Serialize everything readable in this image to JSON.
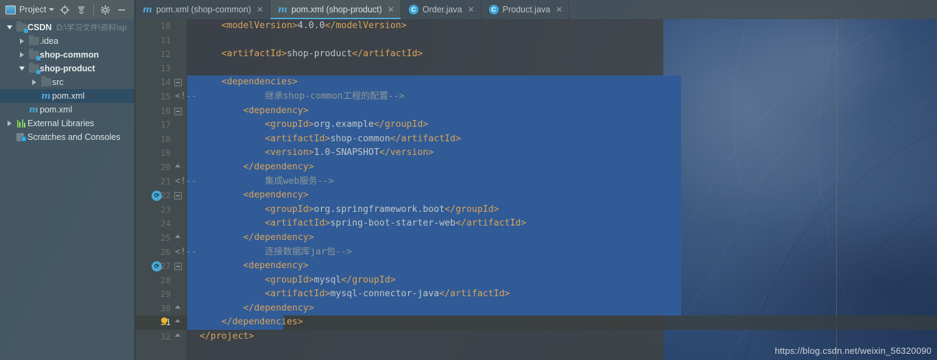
{
  "sidebar": {
    "toolbar": {
      "title": "Project",
      "title_icon": "project-panel-icon",
      "caret_icon": "chevron-down-icon",
      "locate_icon": "locate-target-icon",
      "collapse_icon": "collapse-all-icon",
      "settings_icon": "gear-icon",
      "hide_icon": "minimize-icon"
    },
    "tree": [
      {
        "label": "CSDN",
        "path": "D:\\学习文件\\资料\\sp",
        "icon": "folder-module-icon",
        "twist": "open",
        "depth": 0,
        "bold": true,
        "selected": false
      },
      {
        "label": ".idea",
        "path": "",
        "icon": "folder-icon",
        "twist": "closed",
        "depth": 1,
        "bold": false,
        "selected": false
      },
      {
        "label": "shop-common",
        "path": "",
        "icon": "folder-module-icon",
        "twist": "closed",
        "depth": 1,
        "bold": true,
        "selected": false
      },
      {
        "label": "shop-product",
        "path": "",
        "icon": "folder-module-icon",
        "twist": "open",
        "depth": 1,
        "bold": true,
        "selected": false
      },
      {
        "label": "src",
        "path": "",
        "icon": "folder-icon",
        "twist": "closed",
        "depth": 2,
        "bold": false,
        "selected": false
      },
      {
        "label": "pom.xml",
        "path": "",
        "icon": "maven-file-icon",
        "twist": "none",
        "depth": 2,
        "bold": false,
        "selected": true
      },
      {
        "label": "pom.xml",
        "path": "",
        "icon": "maven-file-icon",
        "twist": "none",
        "depth": 1,
        "bold": false,
        "selected": false
      },
      {
        "label": "External Libraries",
        "path": "",
        "icon": "external-libraries-icon",
        "twist": "closed",
        "depth": 0,
        "bold": false,
        "selected": false
      },
      {
        "label": "Scratches and Consoles",
        "path": "",
        "icon": "scratches-icon",
        "twist": "none",
        "depth": 0,
        "bold": false,
        "selected": false
      }
    ]
  },
  "tabs": [
    {
      "label": "pom.xml (shop-common)",
      "icon": "maven-file-icon",
      "icon_letter": "m",
      "active": false,
      "close_icon": "close-icon"
    },
    {
      "label": "pom.xml (shop-product)",
      "icon": "maven-file-icon",
      "icon_letter": "m",
      "active": true,
      "close_icon": "close-icon"
    },
    {
      "label": "Order.java",
      "icon": "java-class-icon",
      "icon_letter": "C",
      "active": false,
      "close_icon": "close-icon"
    },
    {
      "label": "Product.java",
      "icon": "java-class-icon",
      "icon_letter": "C",
      "active": false,
      "close_icon": "close-icon"
    }
  ],
  "editor": {
    "first_line_number": 10,
    "current_line_number": 31,
    "lines": [
      {
        "num": 10,
        "indent": 4,
        "selected": false,
        "spans": [
          {
            "t": "<modelVersion>",
            "c": "tg"
          },
          {
            "t": "4.0.0",
            "c": "val"
          },
          {
            "t": "</modelVersion>",
            "c": "tg"
          }
        ]
      },
      {
        "num": 11,
        "indent": 0,
        "selected": false,
        "spans": []
      },
      {
        "num": 12,
        "indent": 4,
        "selected": false,
        "spans": [
          {
            "t": "<artifactId>",
            "c": "tg"
          },
          {
            "t": "shop-product",
            "c": "val"
          },
          {
            "t": "</artifactId>",
            "c": "tg"
          }
        ]
      },
      {
        "num": 13,
        "indent": 0,
        "selected": false,
        "spans": []
      },
      {
        "num": 14,
        "indent": 4,
        "selected": true,
        "fold": "minus",
        "sel_start": 0,
        "sel_width": 720,
        "spans": [
          {
            "t": "<dependencies>",
            "c": "tg"
          }
        ]
      },
      {
        "num": 15,
        "indent": 12,
        "selected": true,
        "comment_marker": "<!--",
        "sel_start": 0,
        "sel_width": 720,
        "spans": [
          {
            "t": "继承shop-common工程的配置-->",
            "c": "cm"
          }
        ]
      },
      {
        "num": 16,
        "indent": 8,
        "selected": true,
        "fold": "minus",
        "sel_start": 0,
        "sel_width": 720,
        "spans": [
          {
            "t": "<dependency>",
            "c": "tg"
          }
        ]
      },
      {
        "num": 17,
        "indent": 12,
        "selected": true,
        "sel_start": 0,
        "sel_width": 720,
        "spans": [
          {
            "t": "<groupId>",
            "c": "tg"
          },
          {
            "t": "org.example",
            "c": "val"
          },
          {
            "t": "</groupId>",
            "c": "tg"
          }
        ]
      },
      {
        "num": 18,
        "indent": 12,
        "selected": true,
        "sel_start": 0,
        "sel_width": 720,
        "spans": [
          {
            "t": "<artifactId>",
            "c": "tg"
          },
          {
            "t": "shop-common",
            "c": "val"
          },
          {
            "t": "</artifactId>",
            "c": "tg"
          }
        ]
      },
      {
        "num": 19,
        "indent": 12,
        "selected": true,
        "sel_start": 0,
        "sel_width": 720,
        "spans": [
          {
            "t": "<version>",
            "c": "tg"
          },
          {
            "t": "1.0-SNAPSHOT",
            "c": "val"
          },
          {
            "t": "</version>",
            "c": "tg"
          }
        ]
      },
      {
        "num": 20,
        "indent": 8,
        "selected": true,
        "fold": "arrow-up",
        "sel_start": 0,
        "sel_width": 720,
        "spans": [
          {
            "t": "</dependency>",
            "c": "tg"
          }
        ]
      },
      {
        "num": 21,
        "indent": 12,
        "selected": true,
        "comment_marker": "<!--",
        "sel_start": 0,
        "sel_width": 720,
        "spans": [
          {
            "t": "集成web服务-->",
            "c": "cm"
          }
        ]
      },
      {
        "num": 22,
        "indent": 8,
        "selected": true,
        "fold": "minus",
        "gutter_icon": "maven-dependency-icon",
        "sel_start": 0,
        "sel_width": 720,
        "spans": [
          {
            "t": "<dependency>",
            "c": "tg"
          }
        ]
      },
      {
        "num": 23,
        "indent": 12,
        "selected": true,
        "sel_start": 0,
        "sel_width": 720,
        "spans": [
          {
            "t": "<groupId>",
            "c": "tg"
          },
          {
            "t": "org.springframework.boot",
            "c": "val"
          },
          {
            "t": "</groupId>",
            "c": "tg"
          }
        ]
      },
      {
        "num": 24,
        "indent": 12,
        "selected": true,
        "sel_start": 0,
        "sel_width": 720,
        "spans": [
          {
            "t": "<artifactId>",
            "c": "tg"
          },
          {
            "t": "spring-boot-starter-web",
            "c": "val"
          },
          {
            "t": "</artifactId>",
            "c": "tg"
          }
        ]
      },
      {
        "num": 25,
        "indent": 8,
        "selected": true,
        "fold": "arrow-up",
        "sel_start": 0,
        "sel_width": 720,
        "spans": [
          {
            "t": "</dependency>",
            "c": "tg"
          }
        ]
      },
      {
        "num": 26,
        "indent": 12,
        "selected": true,
        "comment_marker": "<!--",
        "sel_start": 0,
        "sel_width": 720,
        "spans": [
          {
            "t": "连接数据库jar包-->",
            "c": "cm"
          }
        ]
      },
      {
        "num": 27,
        "indent": 8,
        "selected": true,
        "fold": "minus",
        "gutter_icon": "maven-dependency-icon",
        "sel_start": 0,
        "sel_width": 720,
        "spans": [
          {
            "t": "<dependency>",
            "c": "tg"
          }
        ]
      },
      {
        "num": 28,
        "indent": 12,
        "selected": true,
        "sel_start": 0,
        "sel_width": 720,
        "spans": [
          {
            "t": "<groupId>",
            "c": "tg"
          },
          {
            "t": "mysql",
            "c": "val"
          },
          {
            "t": "</groupId>",
            "c": "tg"
          }
        ]
      },
      {
        "num": 29,
        "indent": 12,
        "selected": true,
        "sel_start": 0,
        "sel_width": 720,
        "spans": [
          {
            "t": "<artifactId>",
            "c": "tg"
          },
          {
            "t": "mysql-connector-java",
            "c": "val"
          },
          {
            "t": "</artifactId>",
            "c": "tg"
          }
        ]
      },
      {
        "num": 30,
        "indent": 8,
        "selected": true,
        "fold": "arrow-up",
        "sel_start": 0,
        "sel_width": 720,
        "spans": [
          {
            "t": "</dependency>",
            "c": "tg"
          }
        ]
      },
      {
        "num": 31,
        "indent": 4,
        "selected": true,
        "current": true,
        "fold": "arrow-up",
        "bulb": true,
        "sel_start": 0,
        "sel_width": 140,
        "spans": [
          {
            "t": "</dependencies>",
            "c": "tg"
          }
        ]
      },
      {
        "num": 32,
        "indent": 0,
        "selected": false,
        "fold": "arrow-up",
        "spans": [
          {
            "t": "</project>",
            "c": "tg"
          }
        ]
      }
    ]
  },
  "watermark": "https://blog.csdn.net/weixin_56320090",
  "colors": {
    "selection_blue": "#315b96",
    "tab_active_underline": "#4ea9d8",
    "tag": "#d8a45c",
    "value": "#bfc6c7",
    "comment": "#8d9899",
    "tree_selection": "#2f4d63",
    "maven_icon": "#4ea9d8",
    "bulb": "#f0b429"
  }
}
